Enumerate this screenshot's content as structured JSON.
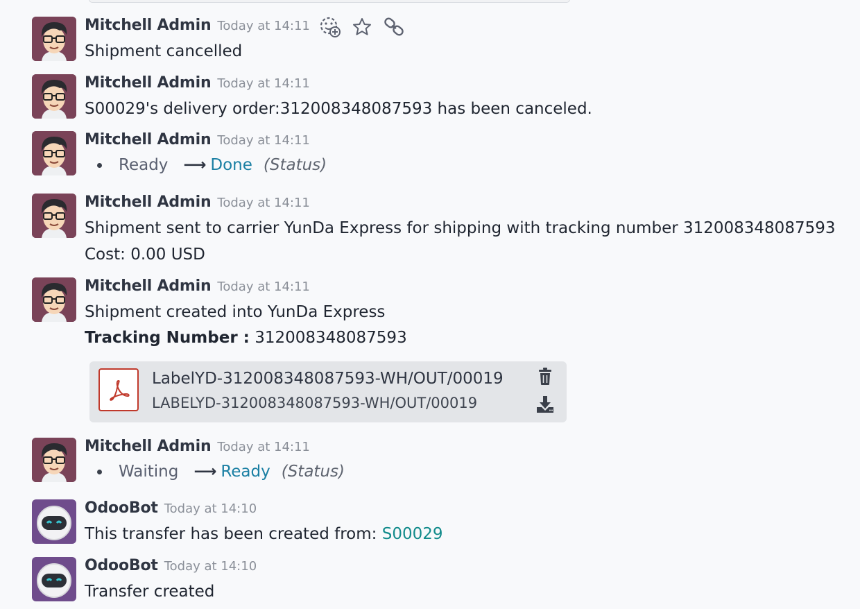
{
  "messages": [
    {
      "author": "Mitchell Admin",
      "date": "Today at 14:11",
      "body": "Shipment cancelled"
    },
    {
      "author": "Mitchell Admin",
      "date": "Today at 14:11",
      "body": "S00029's delivery order:312008348087593 has been canceled."
    },
    {
      "author": "Mitchell Admin",
      "date": "Today at 14:11",
      "tracking": {
        "old": "Ready",
        "new": "Done",
        "field": "(Status)"
      }
    },
    {
      "author": "Mitchell Admin",
      "date": "Today at 14:11",
      "body": "Shipment sent to carrier YunDa Express for shipping with tracking number 312008348087593",
      "body2": "Cost: 0.00 USD"
    },
    {
      "author": "Mitchell Admin",
      "date": "Today at 14:11",
      "body": "Shipment created into YunDa Express",
      "tracking_label": "Tracking Number :",
      "tracking_value": " 312008348087593",
      "attachment": {
        "name": "LabelYD-312008348087593-WH/OUT/00019",
        "ext": "LABELYD-312008348087593-WH/OUT/00019"
      }
    },
    {
      "author": "Mitchell Admin",
      "date": "Today at 14:11",
      "tracking": {
        "old": "Waiting",
        "new": "Ready",
        "field": "(Status)"
      }
    },
    {
      "author": "OdooBot",
      "date": "Today at 14:10",
      "body_prefix": "This transfer has been created from: ",
      "body_link": "S00029"
    },
    {
      "author": "OdooBot",
      "date": "Today at 14:10",
      "body": "Transfer created"
    }
  ],
  "icons": {
    "add_reaction": "smiley-plus-icon",
    "star": "star-icon",
    "link": "link-icon",
    "trash": "trash-icon",
    "download": "download-icon",
    "pdf": "pdf-icon"
  },
  "arrow": "⟶",
  "colors": {
    "accent": "#1a7fa3",
    "link": "#128b8b",
    "pdf": "#c0392b"
  }
}
